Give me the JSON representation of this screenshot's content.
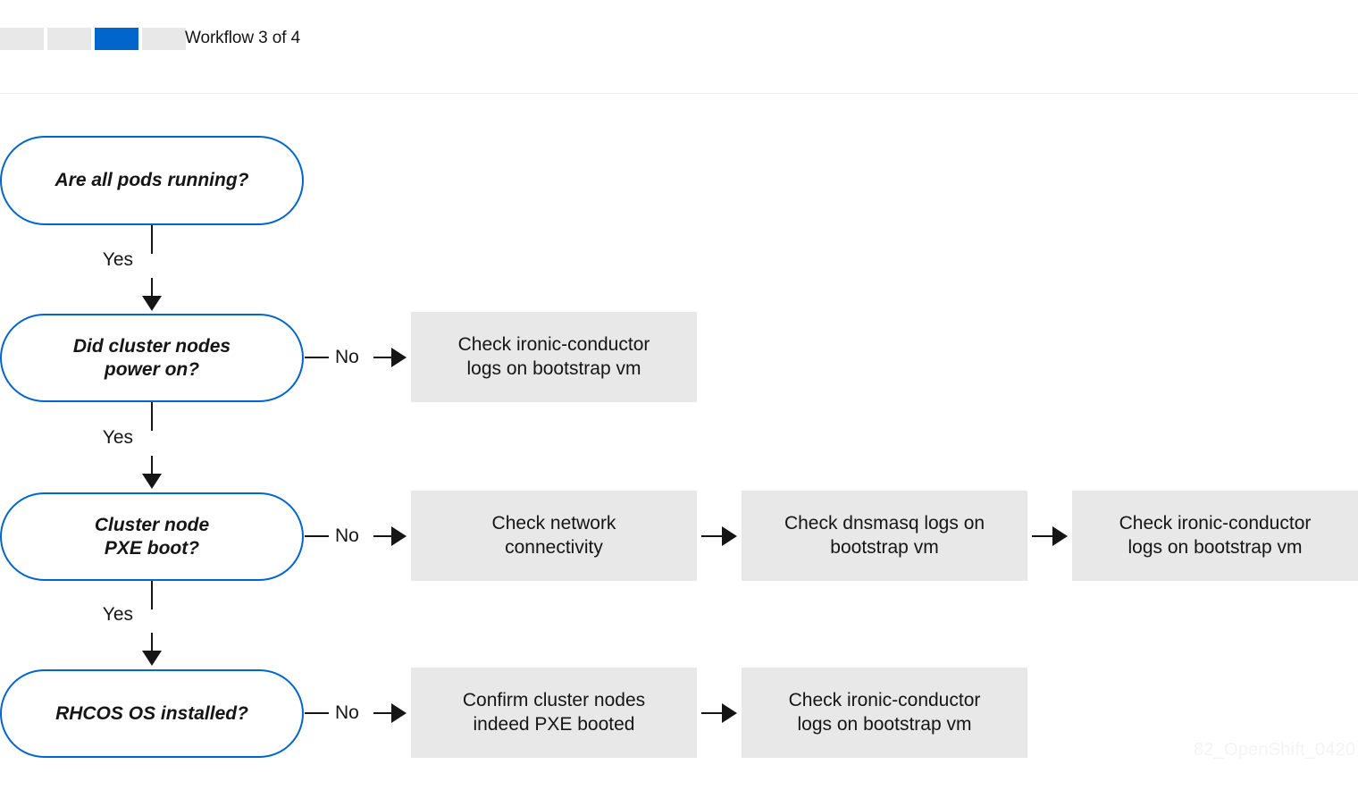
{
  "header": {
    "workflow_label": "Workflow 3 of 4",
    "progress": {
      "total_segments": 4,
      "active_index": 3,
      "active_color": "#0066cc",
      "inactive_color": "#e8e8e8"
    }
  },
  "watermark": {
    "text": "82_OpenShift_0420"
  },
  "colors": {
    "decision_border": "#0066cc",
    "process_fill": "#e8e8e8",
    "text": "#151515",
    "divider": "#ececec"
  },
  "flow": {
    "decisions": [
      {
        "id": "pods-running",
        "label": "Are all pods running?"
      },
      {
        "id": "nodes-power-on",
        "label": "Did cluster nodes\npower on?"
      },
      {
        "id": "pxe-boot",
        "label": "Cluster node\nPXE boot?"
      },
      {
        "id": "rhcos-installed",
        "label": "RHCOS OS installed?"
      }
    ],
    "yes_label": "Yes",
    "no_label": "No",
    "rows": [
      {
        "decision": "nodes-power-on",
        "steps": [
          {
            "id": "r1-s1",
            "label": "Check ironic-conductor\nlogs on bootstrap vm"
          }
        ]
      },
      {
        "decision": "pxe-boot",
        "steps": [
          {
            "id": "r2-s1",
            "label": "Check network\nconnectivity"
          },
          {
            "id": "r2-s2",
            "label": "Check dnsmasq logs on\nbootstrap vm"
          },
          {
            "id": "r2-s3",
            "label": "Check ironic-conductor\nlogs on bootstrap vm"
          }
        ]
      },
      {
        "decision": "rhcos-installed",
        "steps": [
          {
            "id": "r3-s1",
            "label": "Confirm cluster nodes\nindeed PXE booted"
          },
          {
            "id": "r3-s2",
            "label": "Check ironic-conductor\nlogs on bootstrap vm"
          }
        ]
      }
    ]
  }
}
